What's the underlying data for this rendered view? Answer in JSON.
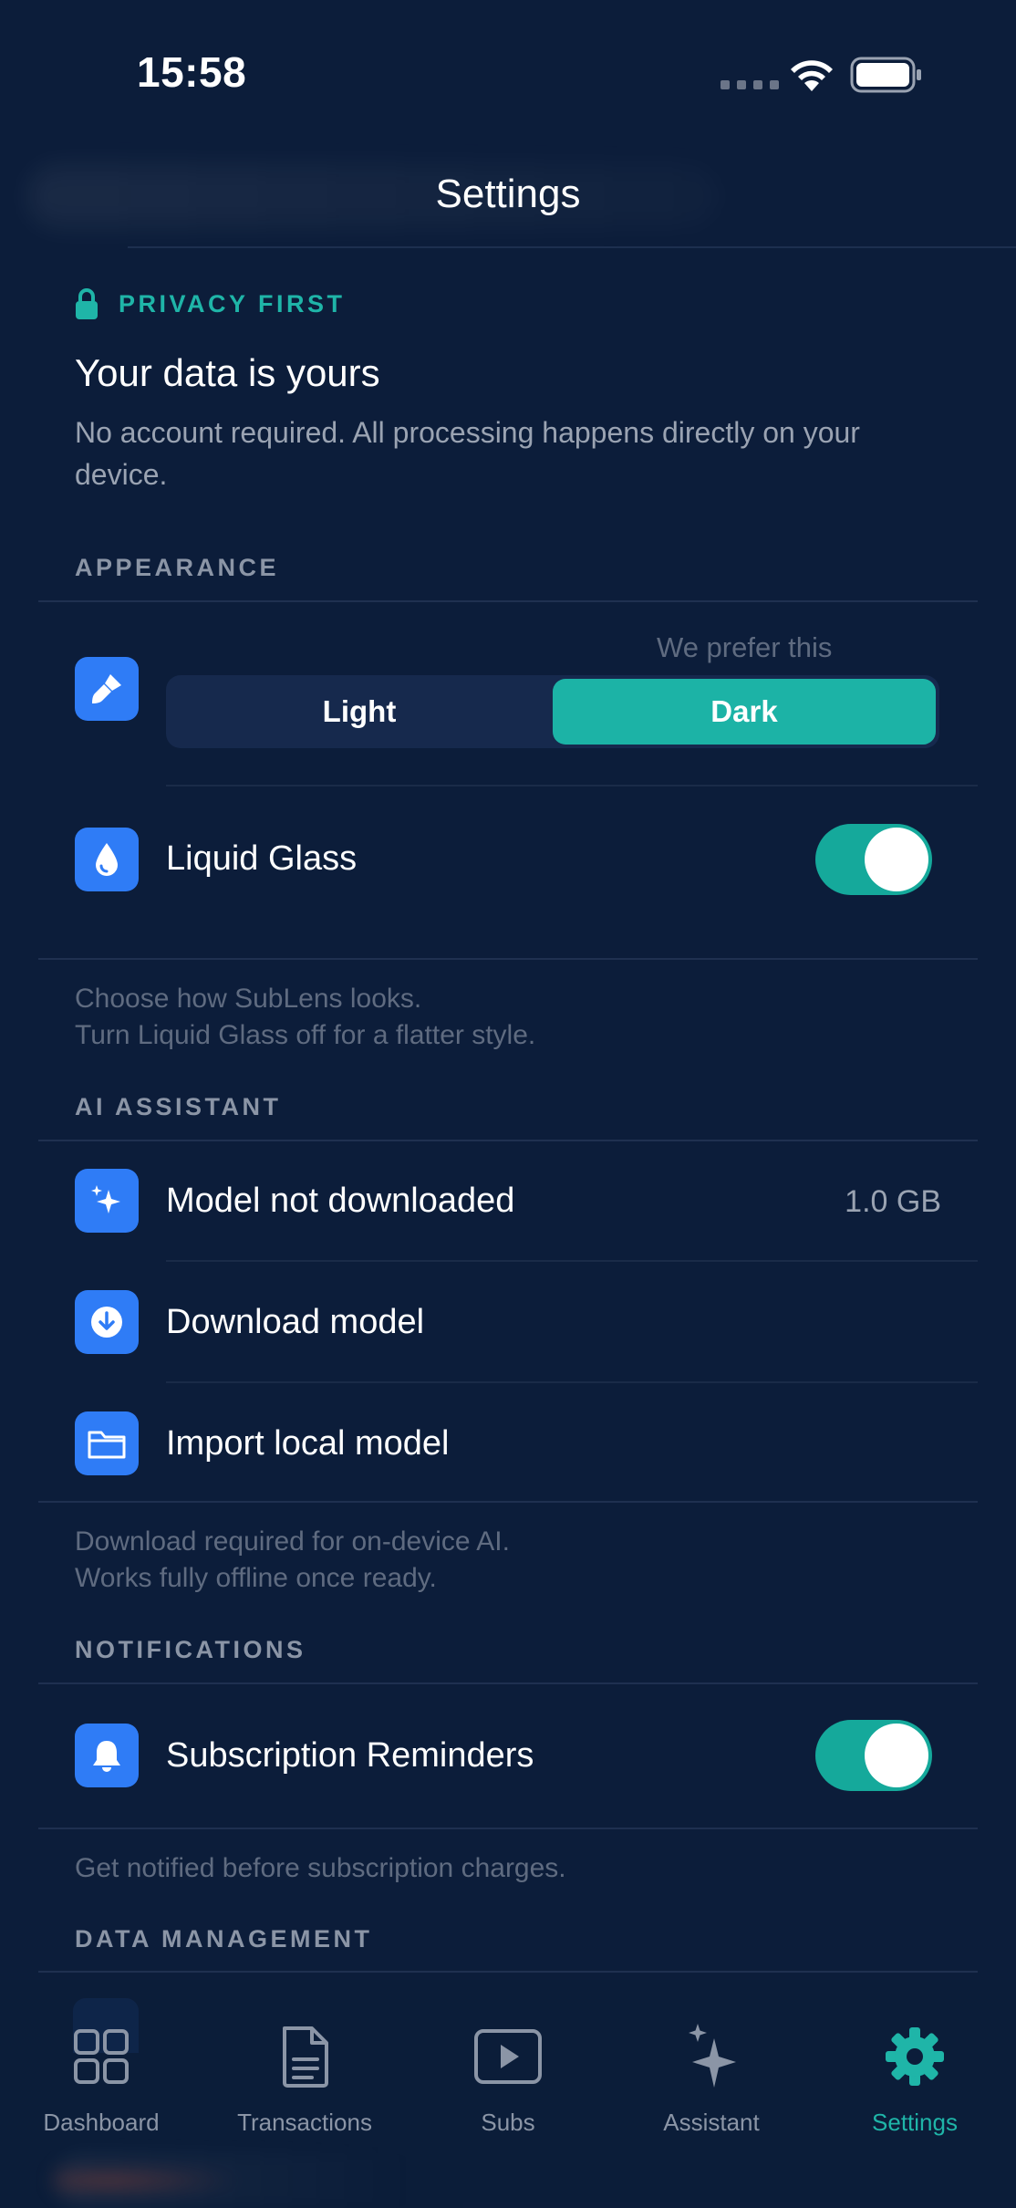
{
  "status_bar": {
    "time": "15:58"
  },
  "nav": {
    "title": "Settings"
  },
  "privacy": {
    "label": "PRIVACY FIRST",
    "title": "Your data is yours",
    "description": "No account required. All processing happens directly on your device."
  },
  "appearance": {
    "header": "APPEARANCE",
    "prefer_note": "We prefer this",
    "options": [
      "Light",
      "Dark"
    ],
    "selected": "Dark",
    "liquid_glass_label": "Liquid Glass",
    "liquid_glass_on": true,
    "footnote_line1": "Choose how SubLens looks.",
    "footnote_line2": "Turn Liquid Glass off for a flatter style."
  },
  "ai_assistant": {
    "header": "AI ASSISTANT",
    "model_status_label": "Model not downloaded",
    "model_size": "1.0 GB",
    "download_label": "Download model",
    "import_label": "Import local model",
    "footnote_line1": "Download required for on-device AI.",
    "footnote_line2": "Works fully offline once ready."
  },
  "notifications": {
    "header": "NOTIFICATIONS",
    "reminders_label": "Subscription Reminders",
    "reminders_on": true,
    "footnote": "Get notified before subscription charges."
  },
  "data_management": {
    "header": "DATA MANAGEMENT"
  },
  "tab_bar": {
    "active": "Settings",
    "tabs": [
      {
        "label": "Dashboard",
        "icon": "grid-icon"
      },
      {
        "label": "Transactions",
        "icon": "document-icon"
      },
      {
        "label": "Subs",
        "icon": "play-icon"
      },
      {
        "label": "Assistant",
        "icon": "sparkle-icon"
      },
      {
        "label": "Settings",
        "icon": "gear-icon"
      }
    ]
  },
  "colors": {
    "background": "#0c1d3a",
    "accent": "#1cb3a6",
    "icon_blue": "#2f7cf6",
    "secondary_text": "#9aa3b2"
  }
}
